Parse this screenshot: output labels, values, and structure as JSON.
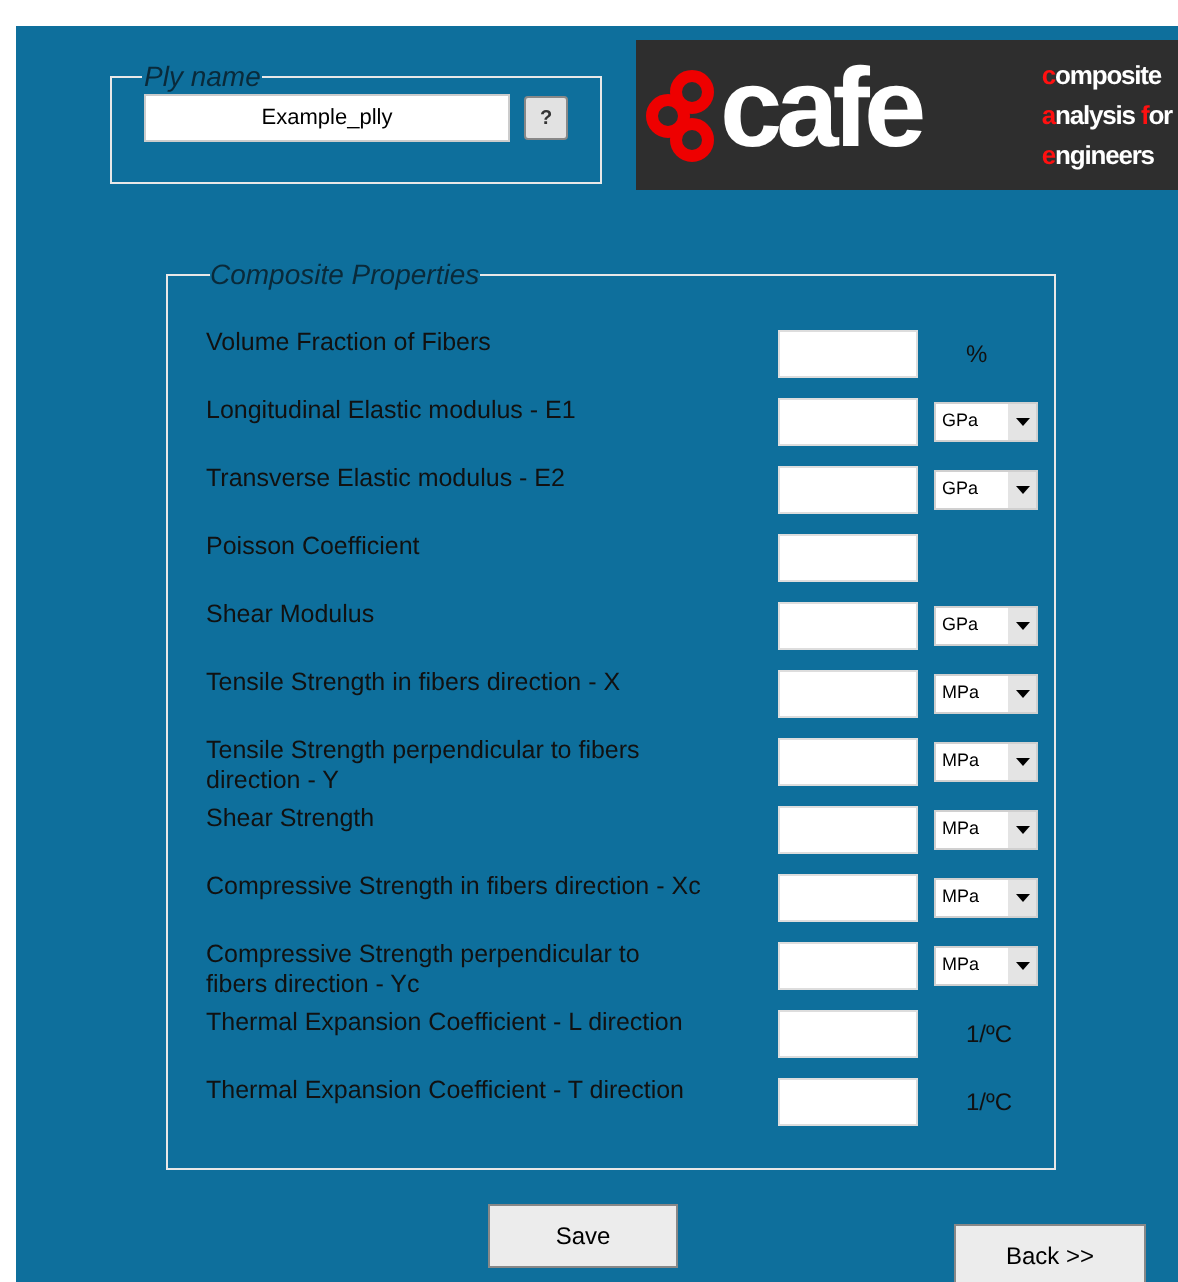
{
  "ply_name": {
    "legend": "Ply name",
    "value": "Example_plly",
    "help_button": "?"
  },
  "logo": {
    "wordmark": "cafe",
    "tagline": [
      [
        {
          "text": "c",
          "accent": true
        },
        {
          "text": "omposite",
          "accent": false
        }
      ],
      [
        {
          "text": "a",
          "accent": true
        },
        {
          "text": "nalysis ",
          "accent": false
        },
        {
          "text": "f",
          "accent": true
        },
        {
          "text": "or",
          "accent": false
        }
      ],
      [
        {
          "text": "e",
          "accent": true
        },
        {
          "text": "ngineers",
          "accent": false
        }
      ]
    ]
  },
  "composite_properties": {
    "legend": "Composite Properties",
    "rows": [
      {
        "label": "Volume Fraction of Fibers",
        "kind": "text",
        "unit": "%"
      },
      {
        "label": "Longitudinal Elastic modulus - E1",
        "kind": "select",
        "unit": "GPa"
      },
      {
        "label": "Transverse Elastic modulus - E2",
        "kind": "select",
        "unit": "GPa"
      },
      {
        "label": "Poisson Coefficient",
        "kind": "none"
      },
      {
        "label": "Shear Modulus",
        "kind": "select",
        "unit": "GPa"
      },
      {
        "label": "Tensile Strength in fibers direction - X",
        "kind": "select",
        "unit": "MPa"
      },
      {
        "label": "Tensile Strength perpendicular to fibers direction - Y",
        "kind": "select",
        "unit": "MPa"
      },
      {
        "label": "Shear Strength",
        "kind": "select",
        "unit": "MPa"
      },
      {
        "label": "Compressive Strength in fibers direction - Xc",
        "kind": "select",
        "unit": "MPa"
      },
      {
        "label": "Compressive Strength perpendicular to fibers direction - Yc",
        "kind": "select",
        "unit": "MPa"
      },
      {
        "label": "Thermal Expansion Coefficient - L direction",
        "kind": "text",
        "unit": "1/ºC"
      },
      {
        "label": "Thermal Expansion Coefficient - T direction",
        "kind": "text",
        "unit": "1/ºC"
      }
    ]
  },
  "buttons": [
    {
      "label": "Save",
      "kind": "save"
    },
    {
      "label": "Back >>",
      "kind": "back"
    }
  ]
}
